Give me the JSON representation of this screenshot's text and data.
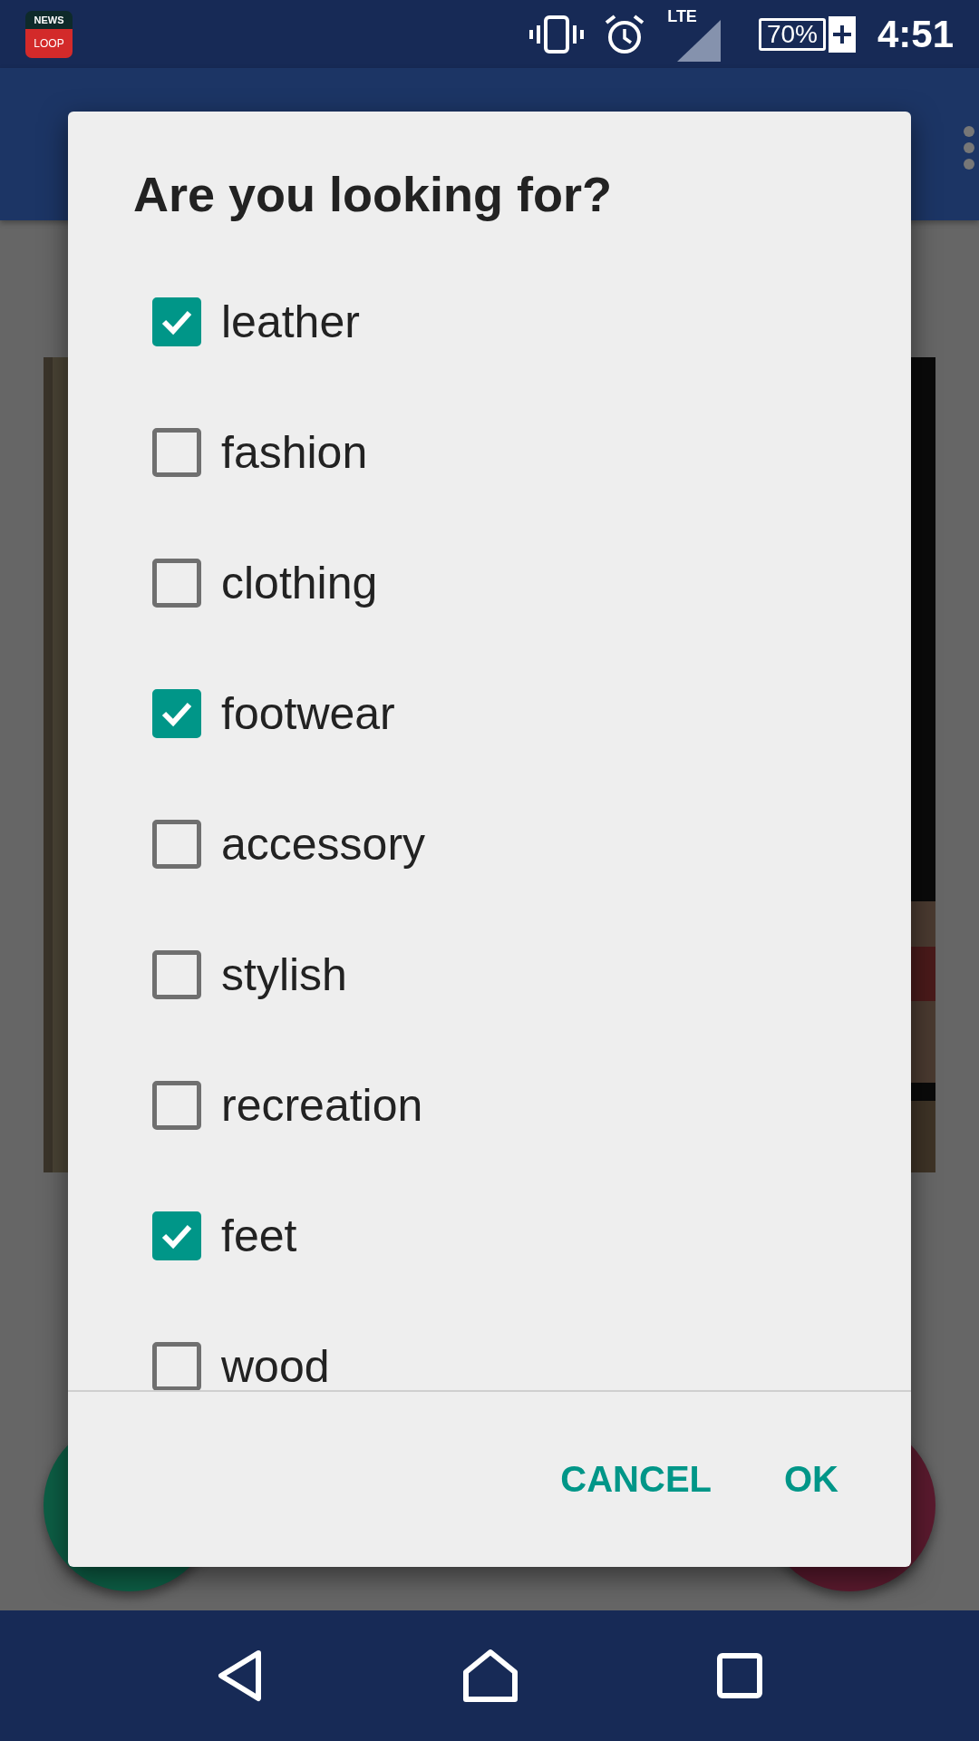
{
  "status_bar": {
    "app_icon_top": "NEWS",
    "app_icon_bottom": "LOOP",
    "network": "LTE",
    "battery": "70%",
    "time": "4:51"
  },
  "dialog": {
    "title": "Are you looking for?",
    "options": [
      {
        "label": "leather",
        "checked": true
      },
      {
        "label": "fashion",
        "checked": false
      },
      {
        "label": "clothing",
        "checked": false
      },
      {
        "label": "footwear",
        "checked": true
      },
      {
        "label": "accessory",
        "checked": false
      },
      {
        "label": "stylish",
        "checked": false
      },
      {
        "label": "recreation",
        "checked": false
      },
      {
        "label": "feet",
        "checked": true
      },
      {
        "label": "wood",
        "checked": false
      }
    ],
    "buttons": [
      {
        "label": "CANCEL"
      },
      {
        "label": "OK"
      }
    ]
  }
}
